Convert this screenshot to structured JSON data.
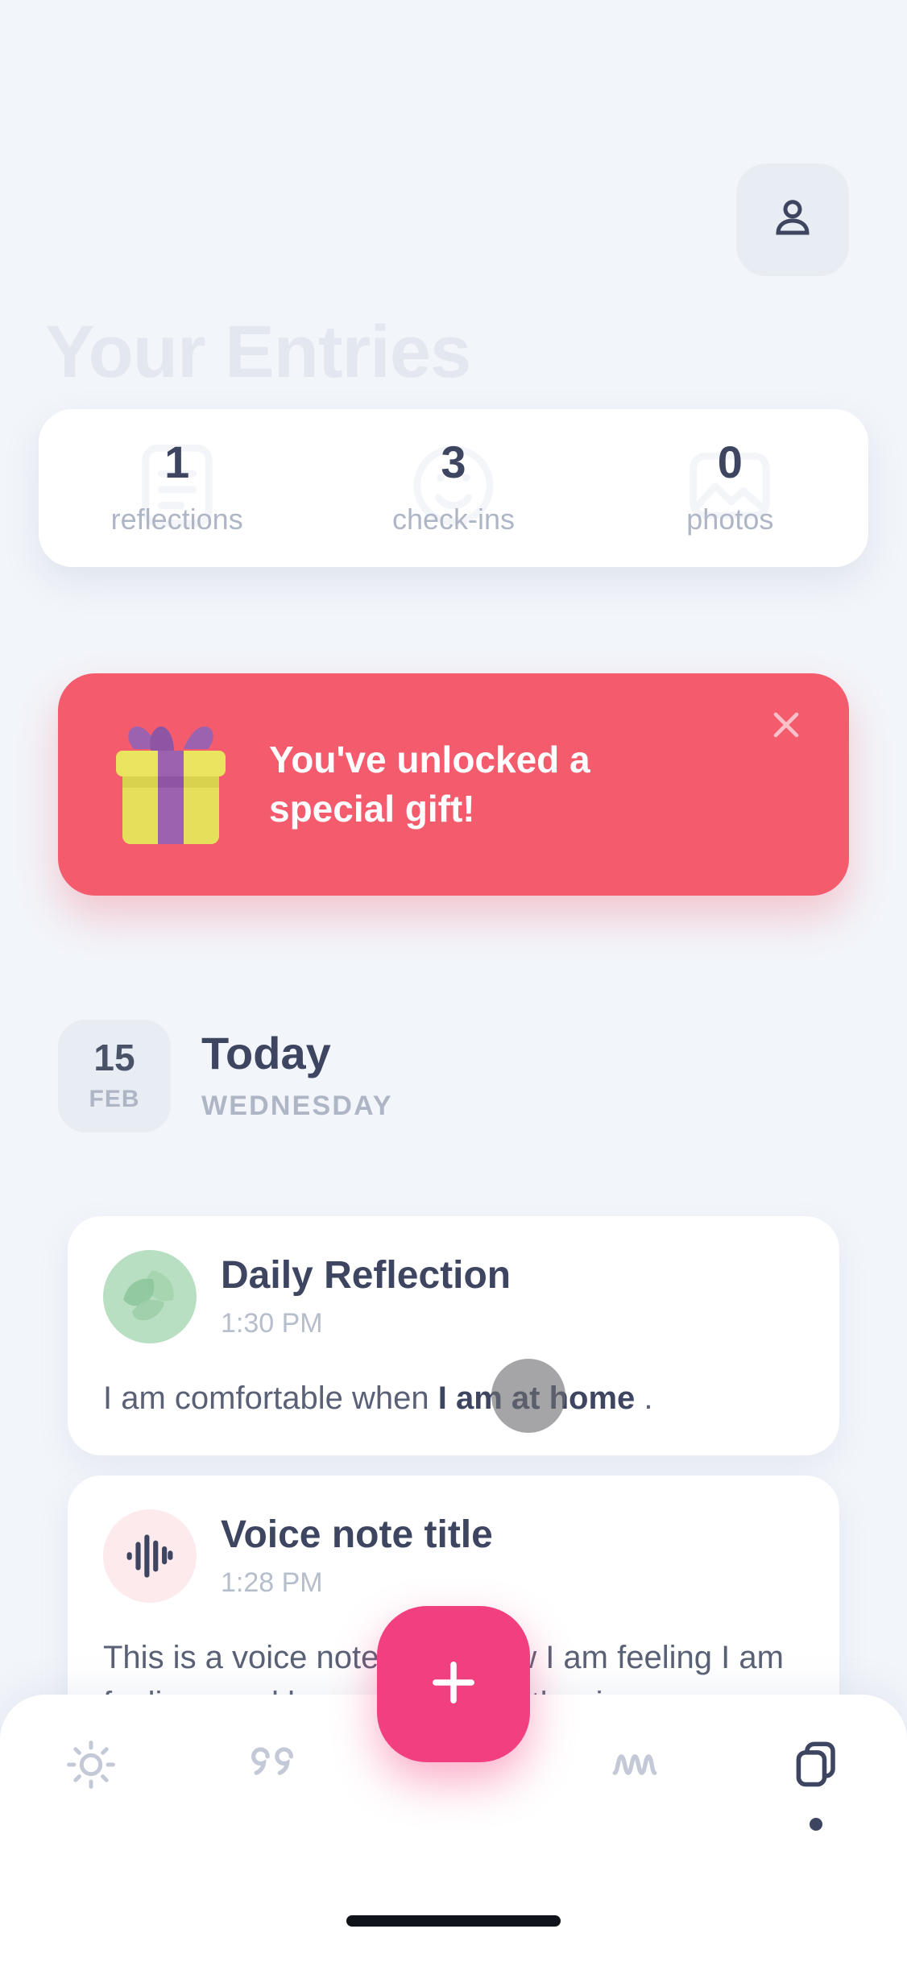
{
  "header": {
    "page_title": "Your Entries",
    "profile_icon": "person-icon"
  },
  "stats": {
    "items": [
      {
        "value": "1",
        "label": "reflections",
        "icon": "document-icon"
      },
      {
        "value": "3",
        "label": "check-ins",
        "icon": "face-icon"
      },
      {
        "value": "0",
        "label": "photos",
        "icon": "photo-icon"
      }
    ]
  },
  "gift_banner": {
    "message": "You've unlocked a special gift!",
    "illustration": "gift-box-icon",
    "close_icon": "close-icon",
    "background_color": "#f45c6e",
    "text_color": "#ffffff"
  },
  "date_header": {
    "day": "15",
    "month": "FEB",
    "title": "Today",
    "weekday": "WEDNESDAY"
  },
  "entries": [
    {
      "icon": "leaf-icon",
      "title": "Daily Reflection",
      "time": "1:30 PM",
      "body_prefix": "I am comfortable when ",
      "body_highlight": "I am at home",
      "body_suffix": " ."
    },
    {
      "icon": "waveform-icon",
      "title": "Voice note title",
      "time": "1:28 PM",
      "body_prefix": "This is a voice note about how I am feeling I am feeling good because the weather is ...",
      "body_highlight": "",
      "body_suffix": ""
    }
  ],
  "bottom_nav": {
    "items": [
      {
        "icon": "sun-icon",
        "active": false
      },
      {
        "icon": "quote-icon",
        "active": false
      },
      {
        "icon": "wave-icon",
        "active": false
      },
      {
        "icon": "cards-icon",
        "active": true
      }
    ],
    "fab": {
      "icon": "plus-icon",
      "label": "",
      "color": "#f23f7f"
    }
  }
}
